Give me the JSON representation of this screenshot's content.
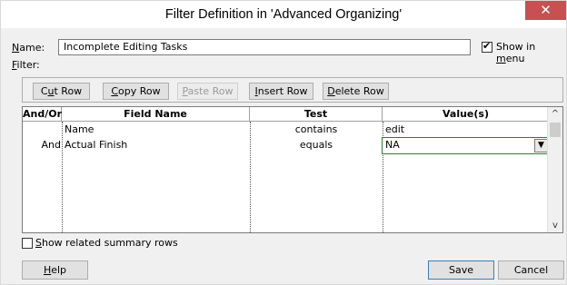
{
  "window": {
    "title": "Filter Definition in 'Advanced Organizing'",
    "close_glyph": "✕"
  },
  "name": {
    "label_accel": "N",
    "label_rest": "ame:",
    "value": "Incomplete Editing Tasks"
  },
  "show_in_menu": {
    "label_pre": "Show in ",
    "label_accel": "m",
    "label_post": "enu",
    "checked": true
  },
  "filter": {
    "label_accel": "F",
    "label_rest": "ilter:"
  },
  "toolbar": {
    "cut_row": {
      "pre": "C",
      "accel": "u",
      "post": "t Row"
    },
    "copy_row": {
      "pre": "",
      "accel": "C",
      "post": "opy Row"
    },
    "paste_row": {
      "pre": "",
      "accel": "P",
      "post": "aste Row",
      "disabled": true
    },
    "insert_row": {
      "pre": "",
      "accel": "I",
      "post": "nsert Row"
    },
    "delete_row": {
      "pre": "",
      "accel": "D",
      "post": "elete Row"
    }
  },
  "grid": {
    "headers": {
      "and_or": "And/Or",
      "field_name": "Field Name",
      "test": "Test",
      "values": "Value(s)"
    },
    "rows": [
      {
        "and_or": "",
        "field_name": "Name",
        "test": "contains",
        "value": "edit"
      },
      {
        "and_or": "And",
        "field_name": "Actual Finish",
        "test": "equals",
        "value": "NA"
      }
    ],
    "scroll_up": "^",
    "scroll_down": "v",
    "dropdown_glyph": "▼"
  },
  "show_related": {
    "label_accel": "S",
    "label_rest": "how related summary rows",
    "checked": false
  },
  "buttons": {
    "help": {
      "accel": "H",
      "rest": "elp"
    },
    "save": "Save",
    "cancel": "Cancel"
  }
}
